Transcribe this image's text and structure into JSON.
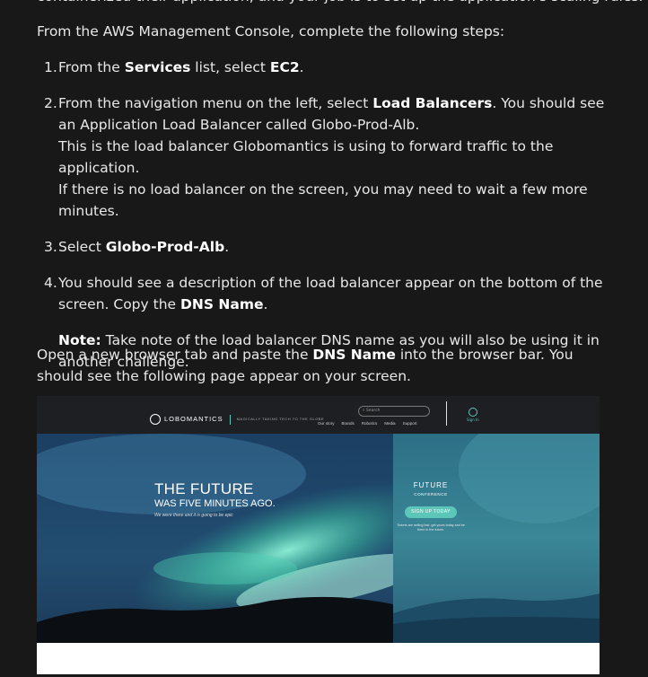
{
  "cut_line": "containerized their application, and your job is to set up the application's scaling rules.",
  "intro": "From the AWS Management Console, complete the following steps:",
  "steps": [
    {
      "num": "1.",
      "pre": "From the ",
      "bold1": "Services",
      "mid": " list, select ",
      "bold2": "EC2",
      "post": "."
    },
    {
      "num": "2.",
      "pre": "From the navigation menu on the left, select ",
      "bold1": "Load Balancers",
      "post": ". You should see an Application Load Balancer called Globo-Prod-Alb.",
      "line2": "This is the load balancer Globomantics is using to forward traffic to the application.",
      "line3": "If there is no load balancer on the screen, you may need to wait a few more minutes."
    },
    {
      "num": "3.",
      "pre": "Select ",
      "bold1": "Globo-Prod-Alb",
      "post": "."
    },
    {
      "num": "4.",
      "pre": "You should see a description of the load balancer appear on the bottom of the screen. Copy the ",
      "bold1": "DNS Name",
      "post": ".",
      "note_label": "Note:",
      "note_text": " Take note of the load balancer DNS name as you will also be using it in another challenge."
    }
  ],
  "open_tab": {
    "pre": "Open a new browser tab and paste the ",
    "bold": "DNS Name",
    "post": " into the browser bar. You should see the following page appear on your screen."
  },
  "screenshot": {
    "logo_letter": "G",
    "logo_text": "LOBOMANTICS",
    "tagline": "Magically taking tech to the globe",
    "search_placeholder": "Search",
    "nav_links": [
      "Our story",
      "Brands",
      "Robotics",
      "Media",
      "Support"
    ],
    "signin": "Sign In",
    "hero_line1": "THE FUTURE",
    "hero_line2": "WAS FIVE MINUTES AGO.",
    "hero_sub": "We were there and it is going to be epic",
    "side_title": "FUTURE",
    "side_sub": "CONFERENCE",
    "signup": "SIGN UP TODAY",
    "side_note": "Tickets are selling fast, get yours today and be there in the future.",
    "colors": {
      "accent": "#5cc7b9",
      "nav_bg": "#1d1f22",
      "page_bg": "#181818"
    }
  }
}
